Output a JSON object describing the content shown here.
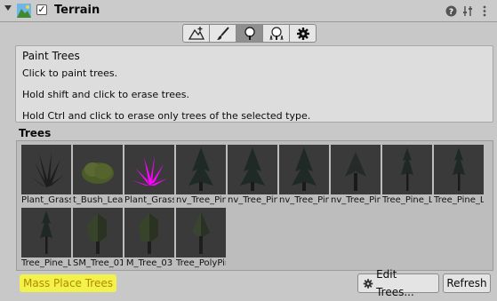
{
  "header": {
    "title": "Terrain",
    "enabled_mark": "✓",
    "icons": [
      "terrain-component-icon",
      "help-icon",
      "preset-icon",
      "more-options-icon"
    ]
  },
  "toolbar": {
    "tools": [
      "raise-terrain-tool",
      "paint-texture-tool",
      "paint-trees-tool",
      "paint-details-tool",
      "terrain-settings-tool"
    ],
    "active": "paint-trees-tool"
  },
  "help": {
    "title": "Paint Trees",
    "lines": [
      "Click to paint trees.",
      "Hold shift and click to erase trees.",
      "Hold Ctrl and click to erase only trees of the selected type."
    ]
  },
  "trees_label": "Trees",
  "trees": [
    {
      "label": "Plant_Grass",
      "kind": "grass"
    },
    {
      "label": "t_Bush_Lea",
      "kind": "bush"
    },
    {
      "label": "Plant_Grass",
      "kind": "grass-missing"
    },
    {
      "label": "nv_Tree_Pin",
      "kind": "pine"
    },
    {
      "label": "nv_Tree_Pin",
      "kind": "pine"
    },
    {
      "label": "nv_Tree_Pin",
      "kind": "pine"
    },
    {
      "label": "nv_Tree_Pin",
      "kind": "pine-low"
    },
    {
      "label": "Tree_Pine_L",
      "kind": "pine-thin"
    },
    {
      "label": "Tree_Pine_L",
      "kind": "pine-thin"
    },
    {
      "label": "Tree_Pine_L",
      "kind": "pine-thin"
    },
    {
      "label": "SM_Tree_01",
      "kind": "poly"
    },
    {
      "label": "M_Tree_03",
      "kind": "poly"
    },
    {
      "label": "Tree_PolyPin",
      "kind": "poly-pine"
    }
  ],
  "buttons": {
    "mass_place": "Mass Place Trees",
    "edit_trees": "Edit Trees...",
    "refresh": "Refresh"
  },
  "colors": {
    "background": "#c8c8c8",
    "mass_place_highlight": "#f2f24a",
    "mass_place_text": "#b08a00",
    "missing_texture": "#ff00ff"
  }
}
